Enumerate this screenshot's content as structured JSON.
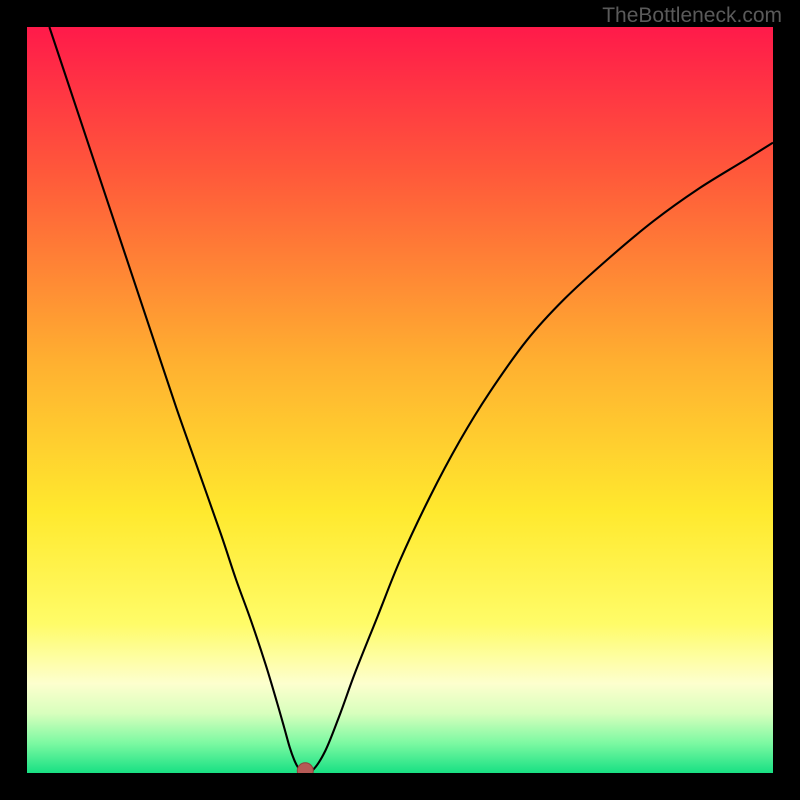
{
  "watermark": "TheBottleneck.com",
  "chart_data": {
    "type": "line",
    "title": "",
    "xlabel": "",
    "ylabel": "",
    "xlim": [
      0,
      100
    ],
    "ylim": [
      0,
      100
    ],
    "background_gradient": {
      "stops": [
        {
          "pos": 0.0,
          "color": "#ff1a4a"
        },
        {
          "pos": 0.2,
          "color": "#ff5a3a"
        },
        {
          "pos": 0.45,
          "color": "#ffb030"
        },
        {
          "pos": 0.65,
          "color": "#ffe92e"
        },
        {
          "pos": 0.8,
          "color": "#fffc68"
        },
        {
          "pos": 0.88,
          "color": "#fdffce"
        },
        {
          "pos": 0.92,
          "color": "#d8ffbd"
        },
        {
          "pos": 0.96,
          "color": "#7cf9a2"
        },
        {
          "pos": 1.0,
          "color": "#18e083"
        }
      ]
    },
    "series": [
      {
        "name": "bottleneck-curve",
        "color": "#000000",
        "width": 2.1,
        "x": [
          3,
          5,
          8,
          11,
          14,
          17,
          20,
          23,
          26,
          28,
          30,
          32,
          33.5,
          34.5,
          35.2,
          35.8,
          36.3,
          36.8,
          38.2,
          40,
          42,
          44,
          47,
          50,
          54,
          58,
          62,
          67,
          72,
          78,
          84,
          90,
          96,
          100
        ],
        "y": [
          100,
          94,
          85,
          76,
          67,
          58,
          49,
          40.5,
          32,
          26,
          20.5,
          14.5,
          9.5,
          6,
          3.5,
          1.8,
          0.8,
          0.3,
          0.3,
          3,
          8,
          13.5,
          21,
          28.5,
          37,
          44.5,
          51,
          58,
          63.5,
          69,
          74,
          78.3,
          82,
          84.5
        ]
      }
    ],
    "marker": {
      "name": "minimum-point",
      "x": 37.3,
      "y": 0.3,
      "radius": 8,
      "fill": "#b65a56",
      "stroke": "#923f3c"
    }
  }
}
